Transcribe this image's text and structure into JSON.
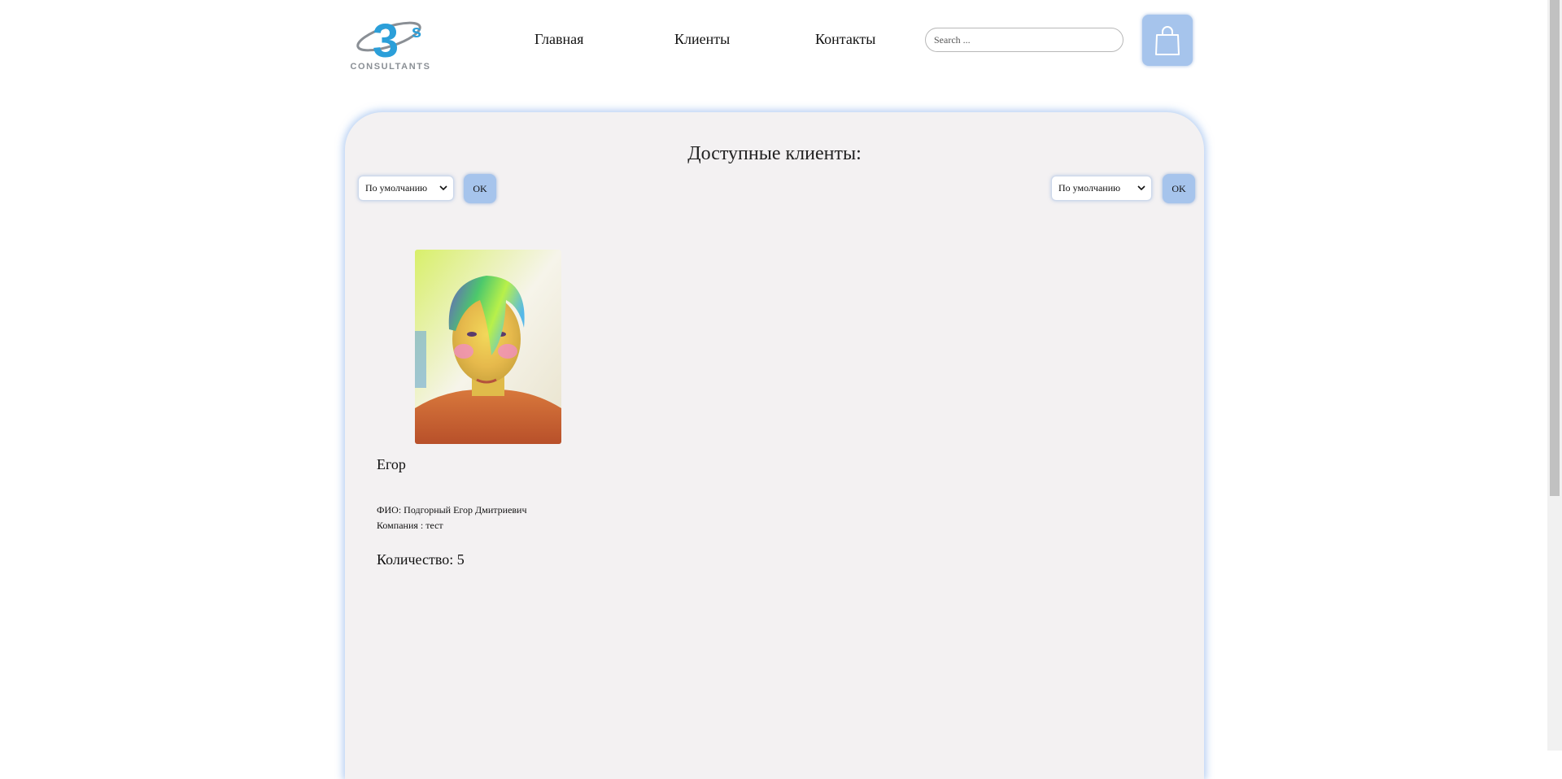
{
  "brand": {
    "logo_text": "CONSULTANTS",
    "logo_mark": "3S"
  },
  "nav": {
    "items": [
      "Главная",
      "Клиенты",
      "Контакты"
    ]
  },
  "search": {
    "placeholder": "Search ..."
  },
  "cart": {
    "icon": "shopping-bag-icon"
  },
  "main": {
    "title": "Доступные клиенты:",
    "sort_left": {
      "selected": "По умолчанию",
      "ok_label": "OK"
    },
    "sort_right": {
      "selected": "По умолчанию",
      "ok_label": "OK"
    }
  },
  "clients": [
    {
      "name": "Егор",
      "fio": "ФИО: Подгорный Егор Дмитриевич",
      "company": "Компания : тест",
      "quantity": "Количество: 5"
    }
  ],
  "colors": {
    "accent": "#a6c4ec",
    "logo_blue": "#2b9fd9",
    "panel_bg": "#f3f1f2",
    "logo_gray": "#8a8f95"
  }
}
